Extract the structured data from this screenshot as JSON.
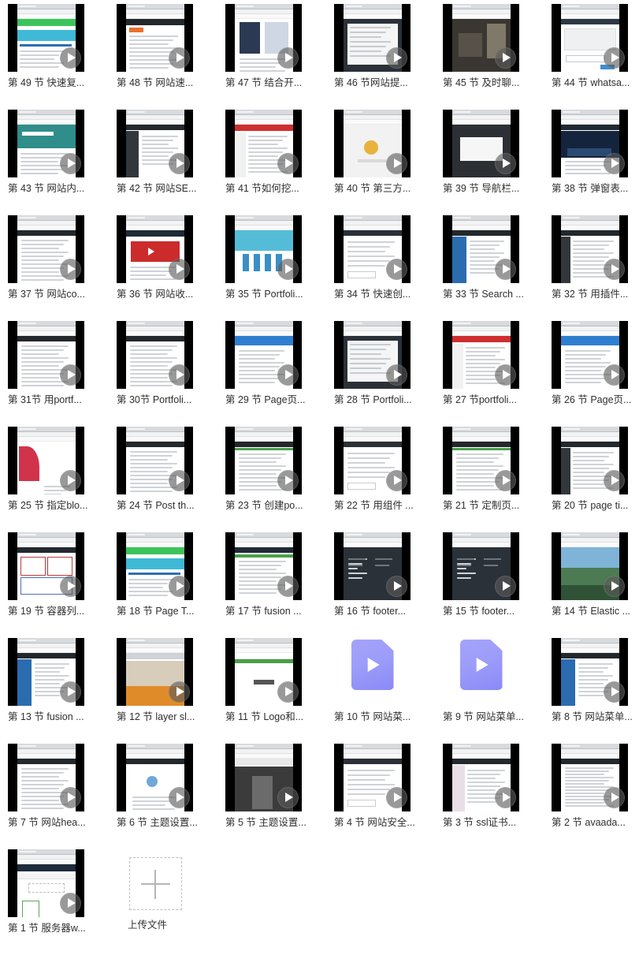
{
  "gallery": {
    "columns": 6,
    "label_color": "#2f2f2f",
    "play_overlay_color": "#5a5a5a",
    "video_file_icon_color": "#9e9efa",
    "items": [
      {
        "label": "第 49 节 快速复...",
        "icon": "play-overlay-icon",
        "thumb": "browser-green-banner"
      },
      {
        "label": "第 48 节 网站速...",
        "icon": "play-overlay-icon",
        "thumb": "browser-report-page"
      },
      {
        "label": "第 47 节 结合开...",
        "icon": "play-overlay-icon",
        "thumb": "browser-dna-image"
      },
      {
        "label": "第 46 节网站提...",
        "icon": "play-overlay-icon",
        "thumb": "browser-dark-editor"
      },
      {
        "label": "第 45 节 及时聊...",
        "icon": "play-overlay-icon",
        "thumb": "photo-dark-room"
      },
      {
        "label": "第 44 节 whatsa...",
        "icon": "play-overlay-icon",
        "thumb": "browser-form-dialog"
      },
      {
        "label": "第 43 节 网站内...",
        "icon": "play-overlay-icon",
        "thumb": "browser-teal-hero"
      },
      {
        "label": "第 42 节 网站SE...",
        "icon": "play-overlay-icon",
        "thumb": "browser-seo-panel"
      },
      {
        "label": "第 41 节如何挖...",
        "icon": "play-overlay-icon",
        "thumb": "browser-red-table"
      },
      {
        "label": "第 40 节 第三方...",
        "icon": "play-overlay-icon",
        "thumb": "browser-yellow-dog"
      },
      {
        "label": "第 39 节 导航栏...",
        "icon": "play-overlay-icon",
        "thumb": "browser-dark-card"
      },
      {
        "label": "第 38 节 弹窗表...",
        "icon": "play-overlay-icon",
        "thumb": "browser-night-city"
      },
      {
        "label": "第 37 节 网站co...",
        "icon": "play-overlay-icon",
        "thumb": "browser-white-doc"
      },
      {
        "label": "第 36 节 网站收...",
        "icon": "play-overlay-icon",
        "thumb": "browser-video-page"
      },
      {
        "label": "第 35 节 Portfoli...",
        "icon": "play-overlay-icon",
        "thumb": "browser-blue-bottles"
      },
      {
        "label": "第 34 节 快速创...",
        "icon": "play-overlay-icon",
        "thumb": "browser-plain-form"
      },
      {
        "label": "第 33 节 Search ...",
        "icon": "play-overlay-icon",
        "thumb": "browser-blue-sidebar"
      },
      {
        "label": "第 32 节 用插件...",
        "icon": "play-overlay-icon",
        "thumb": "browser-plugin-list"
      },
      {
        "label": "第 31节 用portf...",
        "icon": "play-overlay-icon",
        "thumb": "browser-white-doc"
      },
      {
        "label": "第 30节 Portfoli...",
        "icon": "play-overlay-icon",
        "thumb": "browser-white-doc"
      },
      {
        "label": "第 29 节 Page页...",
        "icon": "play-overlay-icon",
        "thumb": "browser-blue-header"
      },
      {
        "label": "第 28 节 Portfoli...",
        "icon": "play-overlay-icon",
        "thumb": "browser-dark-editor"
      },
      {
        "label": "第 27 节portfoli...",
        "icon": "play-overlay-icon",
        "thumb": "browser-red-table"
      },
      {
        "label": "第 26 节 Page页...",
        "icon": "play-overlay-icon",
        "thumb": "browser-blue-header"
      },
      {
        "label": "第 25 节 指定blo...",
        "icon": "play-overlay-icon",
        "thumb": "browser-red-swirl"
      },
      {
        "label": "第 24 节 Post th...",
        "icon": "play-overlay-icon",
        "thumb": "browser-white-doc"
      },
      {
        "label": "第 23 节 创建po...",
        "icon": "play-overlay-icon",
        "thumb": "browser-list-rows"
      },
      {
        "label": "第 22 节 用组件 ...",
        "icon": "play-overlay-icon",
        "thumb": "browser-plain-form"
      },
      {
        "label": "第 21 节 定制页...",
        "icon": "play-overlay-icon",
        "thumb": "browser-list-rows"
      },
      {
        "label": "第 20 节 page ti...",
        "icon": "play-overlay-icon",
        "thumb": "browser-plugin-list"
      },
      {
        "label": "第 19 节 容器列...",
        "icon": "play-overlay-icon",
        "thumb": "browser-wireframe"
      },
      {
        "label": "第 18 节 Page T...",
        "icon": "play-overlay-icon",
        "thumb": "browser-green-banner"
      },
      {
        "label": "第 17 节 fusion ...",
        "icon": "play-overlay-icon",
        "thumb": "browser-shop-page"
      },
      {
        "label": "第 16 节 footer...",
        "icon": "play-overlay-icon",
        "thumb": "browser-dark-footer"
      },
      {
        "label": "第 15 节 footer...",
        "icon": "play-overlay-icon",
        "thumb": "browser-dark-footer"
      },
      {
        "label": "第 14 节 Elastic ...",
        "icon": "play-overlay-icon",
        "thumb": "photo-mountains"
      },
      {
        "label": "第 13 节 fusion ...",
        "icon": "play-overlay-icon",
        "thumb": "browser-blue-sidebar"
      },
      {
        "label": "第 12 节 layer sl...",
        "icon": "play-overlay-icon",
        "thumb": "photo-market"
      },
      {
        "label": "第 11 节 Logo和...",
        "icon": "play-overlay-icon",
        "thumb": "browser-home-text"
      },
      {
        "label": "第 10 节  网站菜...",
        "icon": "video-file-icon",
        "thumb": "video-file"
      },
      {
        "label": "第 9 节 网站菜单...",
        "icon": "video-file-icon",
        "thumb": "video-file"
      },
      {
        "label": "第 8 节 网站菜单...",
        "icon": "play-overlay-icon",
        "thumb": "browser-blue-sidebar"
      },
      {
        "label": "第 7 节 网站hea...",
        "icon": "play-overlay-icon",
        "thumb": "browser-white-doc"
      },
      {
        "label": "第 6 节 主题设置...",
        "icon": "play-overlay-icon",
        "thumb": "browser-person-illu"
      },
      {
        "label": "第 5 节 主题设置...",
        "icon": "play-overlay-icon",
        "thumb": "photo-shop-dark"
      },
      {
        "label": "第 4 节 网站安全...",
        "icon": "play-overlay-icon",
        "thumb": "browser-plain-form"
      },
      {
        "label": "第 3 节 ssl证书...",
        "icon": "play-overlay-icon",
        "thumb": "browser-pink-panel"
      },
      {
        "label": "第 2 节 avaada...",
        "icon": "play-overlay-icon",
        "thumb": "browser-text-article"
      },
      {
        "label": "第 1 节 服务器w...",
        "icon": "play-overlay-icon",
        "thumb": "browser-dashboard"
      }
    ],
    "upload": {
      "label": "上传文件",
      "icon": "plus-icon"
    }
  }
}
